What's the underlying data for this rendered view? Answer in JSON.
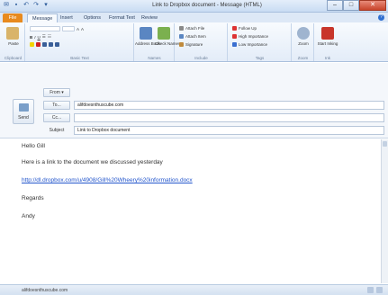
{
  "window": {
    "title": "Link to Dropbox document - Message (HTML)",
    "minimize": "–",
    "maximize": "□",
    "close": "✕"
  },
  "ribbon": {
    "tabs": [
      "File",
      "Message",
      "Insert",
      "Options",
      "Format Text",
      "Review"
    ],
    "active_tab": "Message",
    "groups": {
      "clipboard": {
        "label": "Clipboard",
        "paste": "Paste"
      },
      "basic_text": {
        "label": "Basic Text"
      },
      "names": {
        "label": "Names",
        "address_book": "Address Book",
        "check_names": "Check Names"
      },
      "include": {
        "label": "Include",
        "items": [
          "Attach File",
          "Attach Item",
          "Signature"
        ]
      },
      "tags": {
        "label": "Tags",
        "items": [
          "Follow Up",
          "High Importance",
          "Low Importance"
        ]
      },
      "zoom": {
        "label": "Zoom",
        "button": "Zoom"
      },
      "ink": {
        "label": "Ink",
        "button": "Start Inking"
      }
    }
  },
  "compose": {
    "from_label": "From",
    "send_label": "Send",
    "to_label": "To...",
    "to_value": "alifdoesnthuscube.com",
    "cc_label": "Cc...",
    "cc_value": "",
    "subject_label": "Subject",
    "subject_value": "Link to Dropbox document"
  },
  "body": {
    "greeting": "Hello Gill",
    "line1": "Here is a link to the document we discussed yesterday",
    "link": "http://dl.dropbox.com/u/4908/Gill%20Wheery%20information.docx",
    "regards": "Regards",
    "signature": "Andy"
  },
  "status": {
    "text": "alifdoesnthuscube.com"
  }
}
